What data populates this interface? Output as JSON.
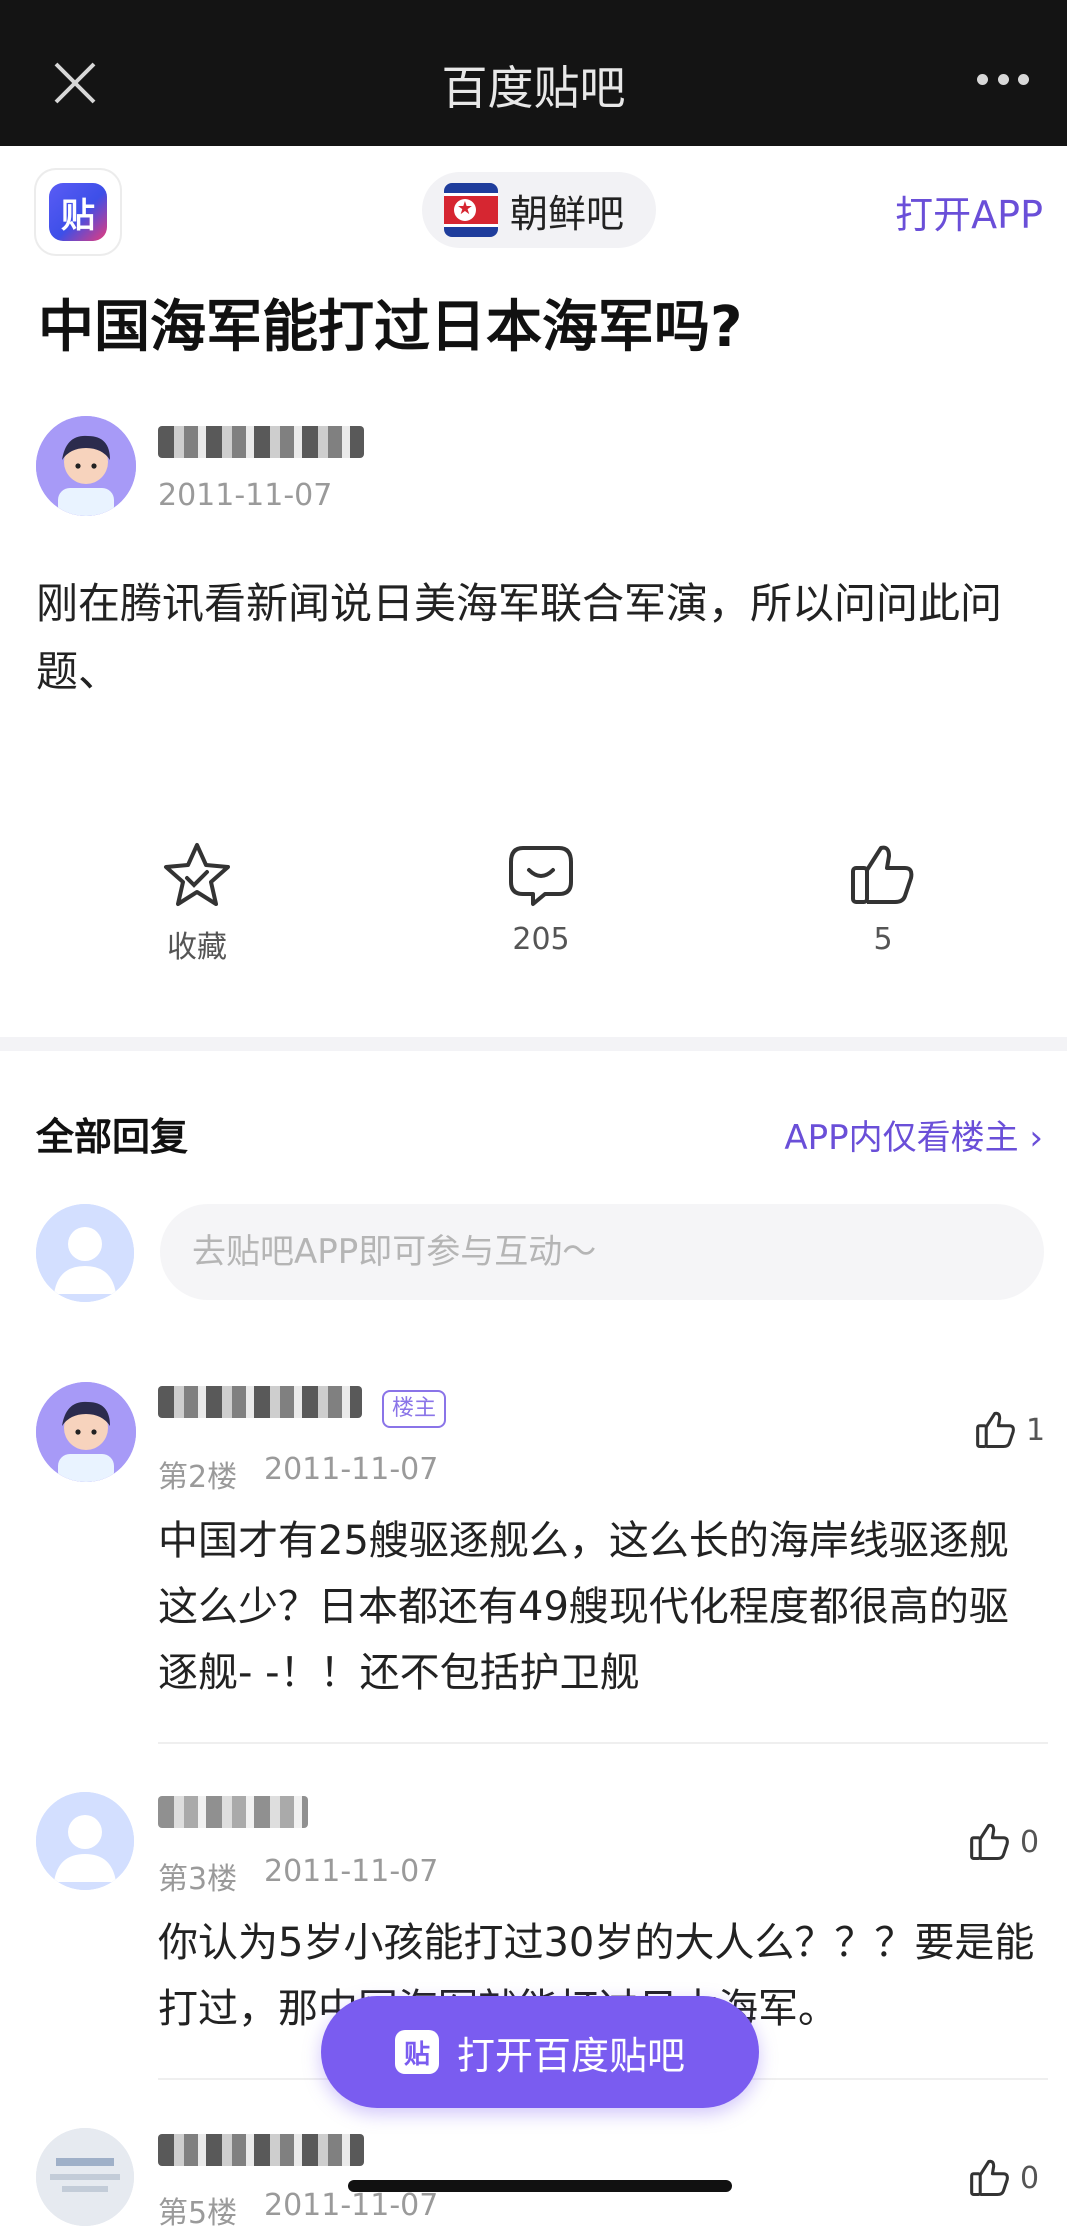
{
  "topbar": {
    "title": "百度贴吧"
  },
  "header": {
    "forum_name": "朝鲜吧",
    "open_app": "打开APP",
    "logo_char": "贴"
  },
  "post": {
    "title": "中国海军能打过日本海军吗?",
    "date": "2011-11-07",
    "content": "刚在腾讯看新闻说日美海军联合军演，所以问问此问题、"
  },
  "actions": {
    "favorite_label": "收藏",
    "comment_count": "205",
    "like_count": "5"
  },
  "replies_section": {
    "title": "全部回复",
    "only_lz": "APP内仅看楼主 ›",
    "input_placeholder": "去贴吧APP即可参与互动～"
  },
  "replies": [
    {
      "badge": "楼主",
      "floor": "第2楼",
      "date": "2011-11-07",
      "likes": "1",
      "text": "中国才有25艘驱逐舰么，这么长的海岸线驱逐舰这么少？日本都还有49艘现代化程度都很高的驱逐舰- -！！还不包括护卫舰"
    },
    {
      "floor": "第3楼",
      "date": "2011-11-07",
      "likes": "0",
      "text": "你认为5岁小孩能打过30岁的大人么？？？要是能打过，那中国海军就能打过日本海军。"
    },
    {
      "floor": "第5楼",
      "date": "2011-11-07",
      "likes": "0",
      "text": ""
    }
  ],
  "floating_button": {
    "label": "打开百度贴吧",
    "icon_char": "贴"
  },
  "colors": {
    "accent": "#6a4fd8",
    "button": "#7a5cf0",
    "topbar": "#141414"
  }
}
